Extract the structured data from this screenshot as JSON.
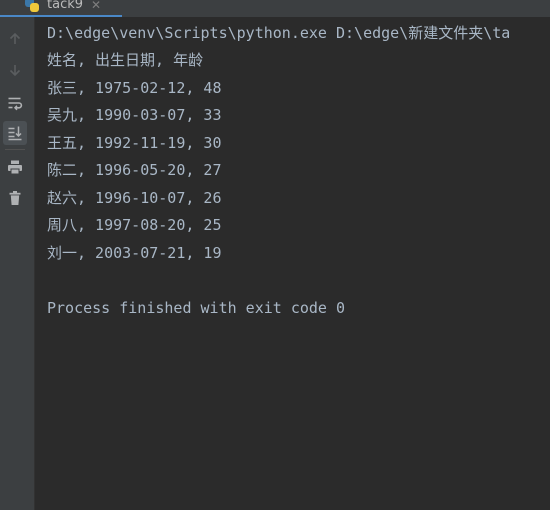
{
  "tab": {
    "title": "tack9",
    "close_glyph": "✕",
    "icon": "python-file-icon"
  },
  "toolbar": {
    "items": [
      {
        "icon": "up-arrow-icon",
        "active": false
      },
      {
        "icon": "down-arrow-icon",
        "active": false
      },
      {
        "icon": "soft-wrap-icon",
        "active": false
      },
      {
        "icon": "scroll-to-end-icon",
        "active": true
      },
      {
        "icon": "print-icon",
        "active": false
      },
      {
        "icon": "trash-icon",
        "active": false
      }
    ]
  },
  "console": {
    "command": "D:\\edge\\venv\\Scripts\\python.exe D:\\edge\\新建文件夹\\ta",
    "lines": [
      "姓名, 出生日期, 年龄",
      "张三, 1975-02-12, 48",
      "吴九, 1990-03-07, 33",
      "王五, 1992-11-19, 30",
      "陈二, 1996-05-20, 27",
      "赵六, 1996-10-07, 26",
      "周八, 1997-08-20, 25",
      "刘一, 2003-07-21, 19"
    ],
    "exit_message": "Process finished with exit code 0"
  },
  "colors": {
    "background": "#2b2b2b",
    "toolbar": "#3c3f41",
    "text": "#a9b7c6",
    "icon": "#afb1b3",
    "icon_disabled": "#5a5d5f"
  }
}
